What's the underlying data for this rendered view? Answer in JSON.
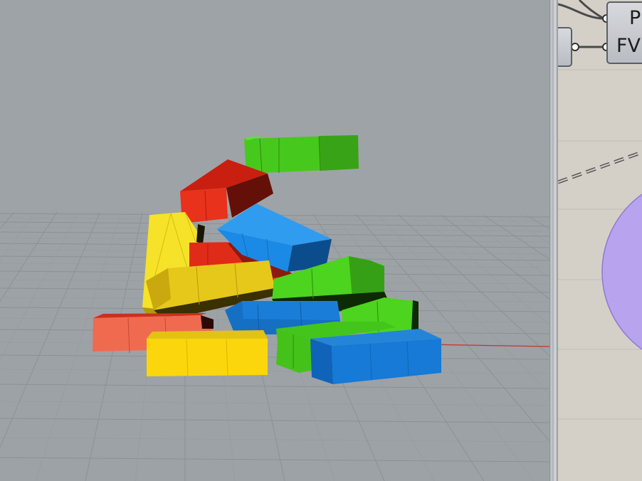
{
  "viewport": {
    "name": "3d-perspective-viewport",
    "colors": {
      "background": "#9ea3a8",
      "grid": "#8a8f94",
      "x_axis": "#c03a2a",
      "red": "#e8321b",
      "blue": "#1e8ae8",
      "green": "#49d21b",
      "yellow": "#f2d418"
    }
  },
  "grasshopper": {
    "component_labels": {
      "line1": "P",
      "line2": "FV"
    },
    "colors": {
      "canvas": "#d4d0c8",
      "circle_fill": "#b7a3ee",
      "wire": "#4a4a4a"
    }
  }
}
